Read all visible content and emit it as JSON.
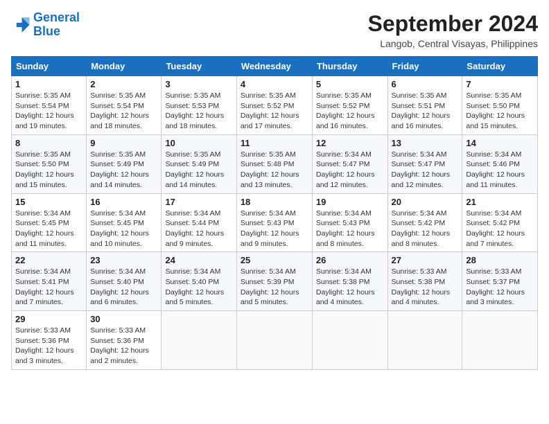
{
  "logo": {
    "line1": "General",
    "line2": "Blue"
  },
  "title": "September 2024",
  "subtitle": "Langob, Central Visayas, Philippines",
  "headers": [
    "Sunday",
    "Monday",
    "Tuesday",
    "Wednesday",
    "Thursday",
    "Friday",
    "Saturday"
  ],
  "weeks": [
    [
      {
        "day": "1",
        "sunrise": "5:35 AM",
        "sunset": "5:54 PM",
        "daylight": "12 hours and 19 minutes."
      },
      {
        "day": "2",
        "sunrise": "5:35 AM",
        "sunset": "5:54 PM",
        "daylight": "12 hours and 18 minutes."
      },
      {
        "day": "3",
        "sunrise": "5:35 AM",
        "sunset": "5:53 PM",
        "daylight": "12 hours and 18 minutes."
      },
      {
        "day": "4",
        "sunrise": "5:35 AM",
        "sunset": "5:52 PM",
        "daylight": "12 hours and 17 minutes."
      },
      {
        "day": "5",
        "sunrise": "5:35 AM",
        "sunset": "5:52 PM",
        "daylight": "12 hours and 16 minutes."
      },
      {
        "day": "6",
        "sunrise": "5:35 AM",
        "sunset": "5:51 PM",
        "daylight": "12 hours and 16 minutes."
      },
      {
        "day": "7",
        "sunrise": "5:35 AM",
        "sunset": "5:50 PM",
        "daylight": "12 hours and 15 minutes."
      }
    ],
    [
      {
        "day": "8",
        "sunrise": "5:35 AM",
        "sunset": "5:50 PM",
        "daylight": "12 hours and 15 minutes."
      },
      {
        "day": "9",
        "sunrise": "5:35 AM",
        "sunset": "5:49 PM",
        "daylight": "12 hours and 14 minutes."
      },
      {
        "day": "10",
        "sunrise": "5:35 AM",
        "sunset": "5:49 PM",
        "daylight": "12 hours and 14 minutes."
      },
      {
        "day": "11",
        "sunrise": "5:35 AM",
        "sunset": "5:48 PM",
        "daylight": "12 hours and 13 minutes."
      },
      {
        "day": "12",
        "sunrise": "5:34 AM",
        "sunset": "5:47 PM",
        "daylight": "12 hours and 12 minutes."
      },
      {
        "day": "13",
        "sunrise": "5:34 AM",
        "sunset": "5:47 PM",
        "daylight": "12 hours and 12 minutes."
      },
      {
        "day": "14",
        "sunrise": "5:34 AM",
        "sunset": "5:46 PM",
        "daylight": "12 hours and 11 minutes."
      }
    ],
    [
      {
        "day": "15",
        "sunrise": "5:34 AM",
        "sunset": "5:45 PM",
        "daylight": "12 hours and 11 minutes."
      },
      {
        "day": "16",
        "sunrise": "5:34 AM",
        "sunset": "5:45 PM",
        "daylight": "12 hours and 10 minutes."
      },
      {
        "day": "17",
        "sunrise": "5:34 AM",
        "sunset": "5:44 PM",
        "daylight": "12 hours and 9 minutes."
      },
      {
        "day": "18",
        "sunrise": "5:34 AM",
        "sunset": "5:43 PM",
        "daylight": "12 hours and 9 minutes."
      },
      {
        "day": "19",
        "sunrise": "5:34 AM",
        "sunset": "5:43 PM",
        "daylight": "12 hours and 8 minutes."
      },
      {
        "day": "20",
        "sunrise": "5:34 AM",
        "sunset": "5:42 PM",
        "daylight": "12 hours and 8 minutes."
      },
      {
        "day": "21",
        "sunrise": "5:34 AM",
        "sunset": "5:42 PM",
        "daylight": "12 hours and 7 minutes."
      }
    ],
    [
      {
        "day": "22",
        "sunrise": "5:34 AM",
        "sunset": "5:41 PM",
        "daylight": "12 hours and 7 minutes."
      },
      {
        "day": "23",
        "sunrise": "5:34 AM",
        "sunset": "5:40 PM",
        "daylight": "12 hours and 6 minutes."
      },
      {
        "day": "24",
        "sunrise": "5:34 AM",
        "sunset": "5:40 PM",
        "daylight": "12 hours and 5 minutes."
      },
      {
        "day": "25",
        "sunrise": "5:34 AM",
        "sunset": "5:39 PM",
        "daylight": "12 hours and 5 minutes."
      },
      {
        "day": "26",
        "sunrise": "5:34 AM",
        "sunset": "5:38 PM",
        "daylight": "12 hours and 4 minutes."
      },
      {
        "day": "27",
        "sunrise": "5:33 AM",
        "sunset": "5:38 PM",
        "daylight": "12 hours and 4 minutes."
      },
      {
        "day": "28",
        "sunrise": "5:33 AM",
        "sunset": "5:37 PM",
        "daylight": "12 hours and 3 minutes."
      }
    ],
    [
      {
        "day": "29",
        "sunrise": "5:33 AM",
        "sunset": "5:36 PM",
        "daylight": "12 hours and 3 minutes."
      },
      {
        "day": "30",
        "sunrise": "5:33 AM",
        "sunset": "5:36 PM",
        "daylight": "12 hours and 2 minutes."
      },
      null,
      null,
      null,
      null,
      null
    ]
  ]
}
